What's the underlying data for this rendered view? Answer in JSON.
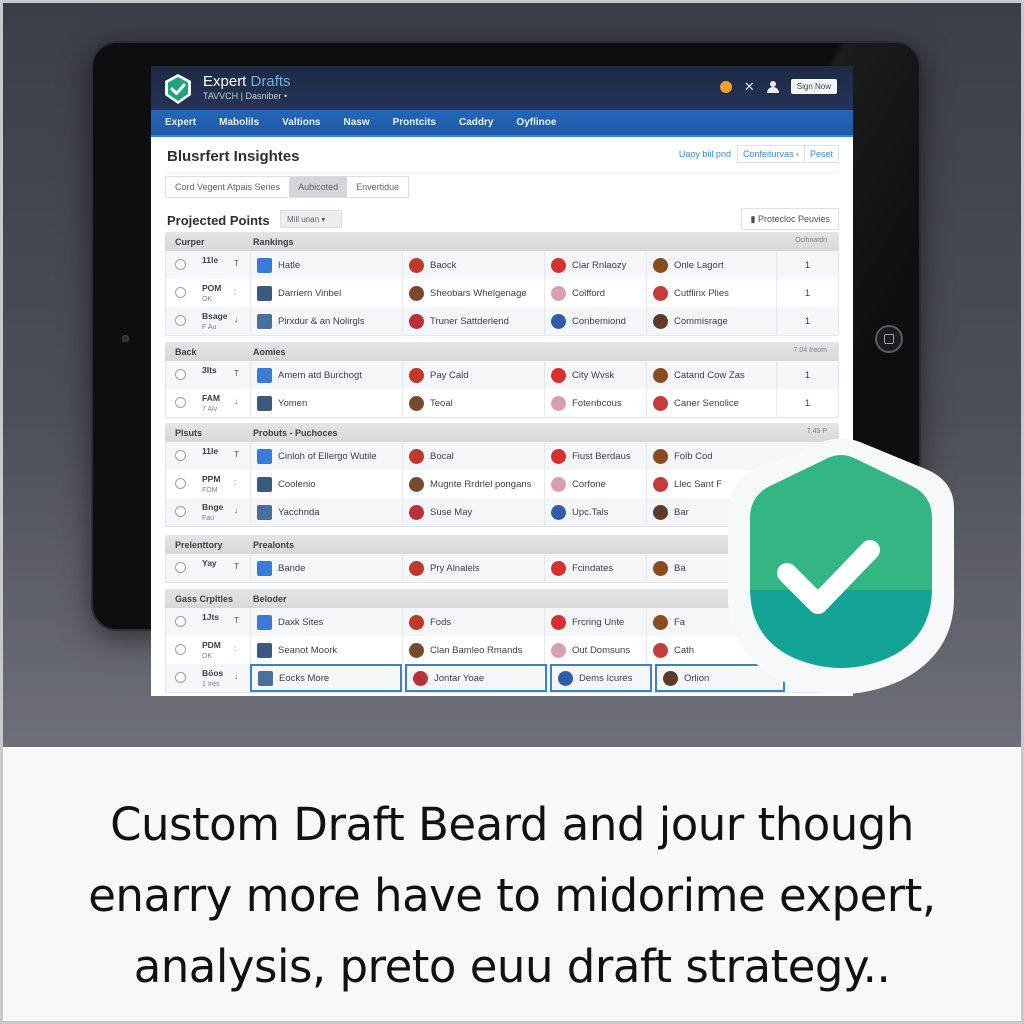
{
  "app": {
    "brand_main": "Expert",
    "brand_accent": "Drafts",
    "subtitle": "TAVVCH | Dasniber •",
    "signin_label": "Sign Now",
    "colors": {
      "topbar": "#1d2a44",
      "navbar": "#2367b8",
      "badge_top": "#34b584",
      "badge_bottom": "#12a596",
      "link": "#3a87d3"
    }
  },
  "nav": [
    "Expert",
    "Mabolils",
    "Valtions",
    "Nasw",
    "Prontcits",
    "Caddry",
    "Oyflinoe"
  ],
  "page": {
    "title": "Blusrfert Insightes",
    "head_link": "Uaoy biil pnd",
    "head_buttons": [
      "Confeiturvas ‹",
      "Peset"
    ],
    "segments": [
      {
        "label": "Cord Vegent Atpais Series",
        "active": false
      },
      {
        "label": "Aubicoted",
        "active": true
      },
      {
        "label": "Envertidue",
        "active": false
      }
    ],
    "projected_title": "Projected Points",
    "projected_select": "Mill unan",
    "projected_button": "Protecloc Peuvies"
  },
  "groups": [
    {
      "col1": "Curper",
      "col2": "Rankings",
      "col3": "Ocihnatdn",
      "rows": [
        {
          "meta1": "11le",
          "meta2": "",
          "mark": "T",
          "cells": [
            "Hatle",
            "Baock",
            "Ciar Rnlaozy",
            "Onle Lagort"
          ],
          "num": "1"
        },
        {
          "meta1": "POM",
          "meta2": "OK",
          "mark": ":",
          "cells": [
            "Darriern Vinbel",
            "Sheobars Whelgenage",
            "Colfford",
            "Cutflinx Plies"
          ],
          "num": "1"
        },
        {
          "meta1": "Bsage",
          "meta2": "F Au",
          "mark": "↓",
          "cells": [
            "Pirxdur & an Nolirgls",
            "Truner Sattderlend",
            "Conbemiond",
            "Commisrage"
          ],
          "num": "1"
        }
      ]
    },
    {
      "col1": "Back",
      "col2": "Aomies",
      "col3": "7.04 Ireom",
      "rows": [
        {
          "meta1": "3Its",
          "meta2": "",
          "mark": "T",
          "cells": [
            "Amem atd Burchogt",
            "Pay Cald",
            "City Wvsk",
            "Catand Cow Zas"
          ],
          "num": "1"
        },
        {
          "meta1": "FAM",
          "meta2": "7 Alv",
          "mark": "↓",
          "cells": [
            "Yomen",
            "Teoal",
            "Fotenbcous",
            "Caner Senolice"
          ],
          "num": "1"
        }
      ]
    },
    {
      "col1": "Plsuts",
      "col2": "Probuts - Puchoces",
      "col3": "7.45 P",
      "rows": [
        {
          "meta1": "11le",
          "meta2": "",
          "mark": "T",
          "cells": [
            "Cinloh of Ellergo Wutile",
            "Bocal",
            "Fiust Berdaus",
            "Folb Cod"
          ],
          "num": ""
        },
        {
          "meta1": "PPM",
          "meta2": "FOM",
          "mark": ":",
          "cells": [
            "Coolenio",
            "Mugnte Rrdrlel pongans",
            "Corfone",
            "Llec Sant F"
          ],
          "num": ""
        },
        {
          "meta1": "Bnge",
          "meta2": "Fau",
          "mark": "↓",
          "cells": [
            "Yacchnda",
            "Suse May",
            "Upc.Tals",
            "Bar"
          ],
          "num": ""
        }
      ]
    },
    {
      "col1": "Prelenttory",
      "col2": "Prealonts",
      "col3": "",
      "rows": [
        {
          "meta1": "Yay",
          "meta2": "",
          "mark": "T",
          "cells": [
            "Bande",
            "Pry Alnalels",
            "Fcindates",
            "Ba"
          ],
          "num": ""
        }
      ]
    },
    {
      "col1": "Gass Crpltles",
      "col2": "Beloder",
      "col3": "",
      "rows": [
        {
          "meta1": "1Jts",
          "meta2": "",
          "mark": "T",
          "cells": [
            "Daxk Sites",
            "Fods",
            "Frcring Unte",
            "Fa"
          ],
          "num": ""
        },
        {
          "meta1": "PDM",
          "meta2": "OK",
          "mark": ":",
          "cells": [
            "Seanot Moork",
            "Clan Bamleo Rmands",
            "Out Domsuns",
            "Cath"
          ],
          "num": ""
        },
        {
          "meta1": "Böos",
          "meta2": "1 Ires",
          "mark": "↓",
          "cells": [
            "Eocks More",
            "Jontar Yoae",
            "Dems Icures",
            "Orlion"
          ],
          "num": ""
        }
      ]
    }
  ],
  "caption": {
    "line1": "Custom Draft Beard and jour though",
    "line2": "enarry more have to midorime expert,",
    "line3": "analysis, preto euu draft strategy.."
  }
}
